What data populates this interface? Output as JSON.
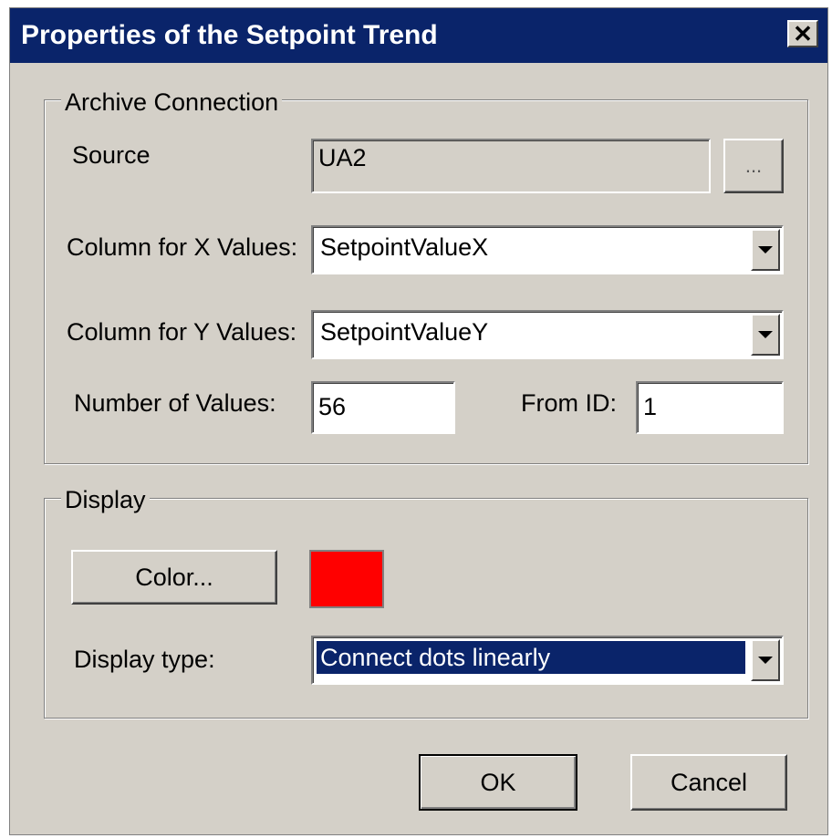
{
  "window": {
    "title": "Properties of the Setpoint Trend",
    "close_glyph": "✕"
  },
  "archive_connection": {
    "legend": "Archive Connection",
    "source_label": "Source",
    "source_value": "UA2",
    "browse_label": "...",
    "x_column_label": "Column for X Values:",
    "x_column_value": "SetpointValueX",
    "y_column_label": "Column for Y Values:",
    "y_column_value": "SetpointValueY",
    "num_values_label": "Number of Values:",
    "num_values_value": "56",
    "from_id_label": "From ID:",
    "from_id_value": "1"
  },
  "display": {
    "legend": "Display",
    "color_button_label": "Color...",
    "color_value": "#ff0000",
    "display_type_label": "Display type:",
    "display_type_value": "Connect dots linearly"
  },
  "footer": {
    "ok_label": "OK",
    "cancel_label": "Cancel"
  },
  "icons": {
    "close": "close-icon",
    "dropdown": "chevron-down-icon"
  }
}
